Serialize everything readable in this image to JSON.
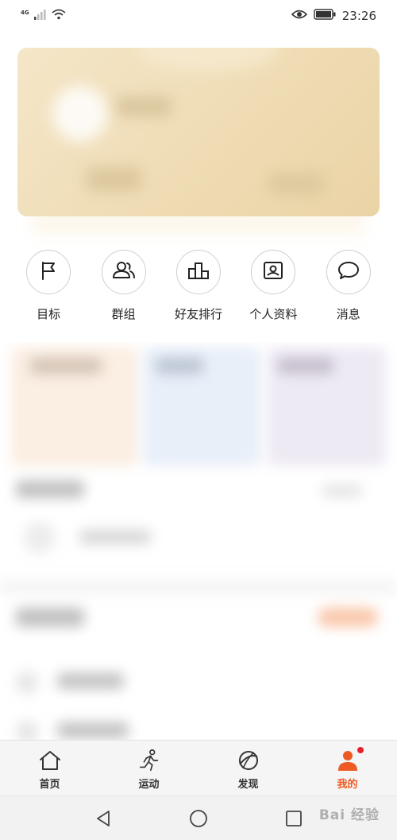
{
  "status_bar": {
    "network_label": "4G",
    "time": "23:26",
    "icons": [
      "signal-icon",
      "wifi-icon",
      "eye-icon",
      "battery-icon"
    ]
  },
  "quick_actions": [
    {
      "label": "目标",
      "icon": "flag-icon"
    },
    {
      "label": "群组",
      "icon": "group-icon"
    },
    {
      "label": "好友排行",
      "icon": "ranking-icon"
    },
    {
      "label": "个人资料",
      "icon": "profile-card-icon"
    },
    {
      "label": "消息",
      "icon": "message-icon"
    }
  ],
  "tab_bar": {
    "active": "我的",
    "items": [
      {
        "label": "首页",
        "icon": "home-icon"
      },
      {
        "label": "运动",
        "icon": "running-icon"
      },
      {
        "label": "发现",
        "icon": "discover-icon"
      },
      {
        "label": "我的",
        "icon": "person-icon"
      }
    ]
  },
  "colors": {
    "accent": "#ee5a24",
    "badge": "#e8202a",
    "card_gold": "#efdcb4"
  },
  "watermark": "Bai 经验"
}
